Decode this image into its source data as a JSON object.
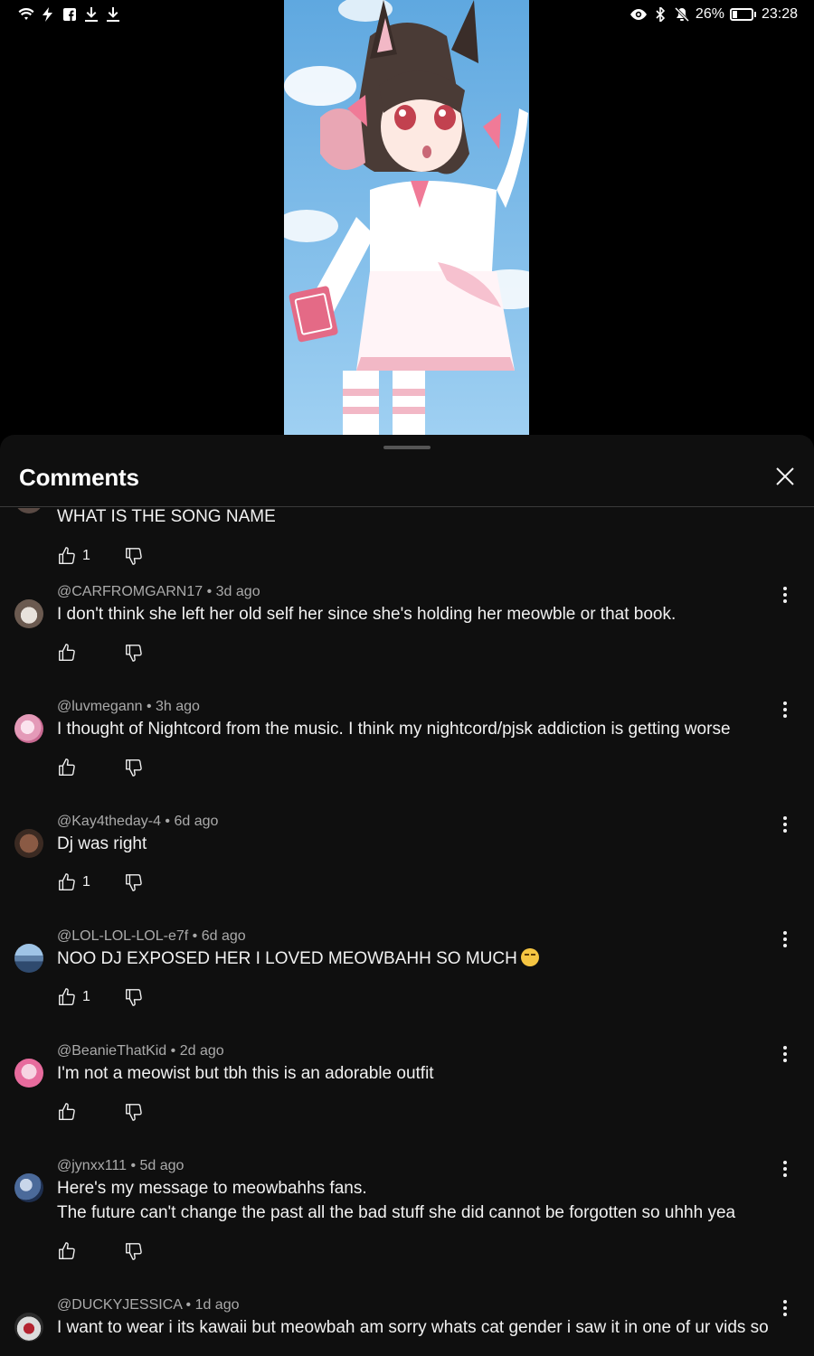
{
  "status_bar": {
    "battery": "26%",
    "time": "23:28"
  },
  "header": {
    "title": "Comments"
  },
  "comments": [
    {
      "author": "",
      "age": "",
      "text": "WHAT IS THE SONG NAME",
      "text2": "",
      "likes": "1"
    },
    {
      "author": "@CARFROMGARN17",
      "age": "3d ago",
      "text": "I don't think she left her old self her since she's holding her meowble or that book.",
      "text2": "",
      "likes": ""
    },
    {
      "author": "@luvmegann",
      "age": "3h ago",
      "text": "I thought of Nightcord from the music. I think my nightcord/pjsk addiction is getting worse",
      "text2": "",
      "likes": ""
    },
    {
      "author": "@Kay4theday-4",
      "age": "6d ago",
      "text": "Dj was right",
      "text2": "",
      "likes": "1"
    },
    {
      "author": "@LOL-LOL-LOL-e7f",
      "age": "6d ago",
      "text": "NOO DJ EXPOSED HER I LOVED MEOWBAHH SO MUCH",
      "text2": "",
      "likes": "1",
      "emoji": "crying-face-emoji"
    },
    {
      "author": "@BeanieThatKid",
      "age": "2d ago",
      "text": "I'm not a meowist but tbh this is an adorable outfit",
      "text2": "",
      "likes": ""
    },
    {
      "author": "@jynxx111",
      "age": "5d ago",
      "text": "Here's my message to meowbahhs fans.",
      "text2": "The future can't change the past all the bad stuff she did cannot be forgotten so uhhh yea",
      "likes": ""
    },
    {
      "author": "@DUCKYJESSICA",
      "age": "1d ago",
      "text": "I want to wear i its kawaii but meowbah am sorry whats cat gender i saw it in one of ur vids so",
      "text2": "",
      "likes": ""
    }
  ],
  "meta_sep": " • ",
  "icons": {
    "like": "thumbs-up-icon",
    "dislike": "thumbs-down-icon",
    "more": "more-vert-icon",
    "close": "close-icon"
  },
  "colors": {
    "background": "#0f0f0f",
    "text": "#f1f1f1",
    "secondary_text": "#aaaaaa",
    "divider": "#3a3a3a"
  }
}
